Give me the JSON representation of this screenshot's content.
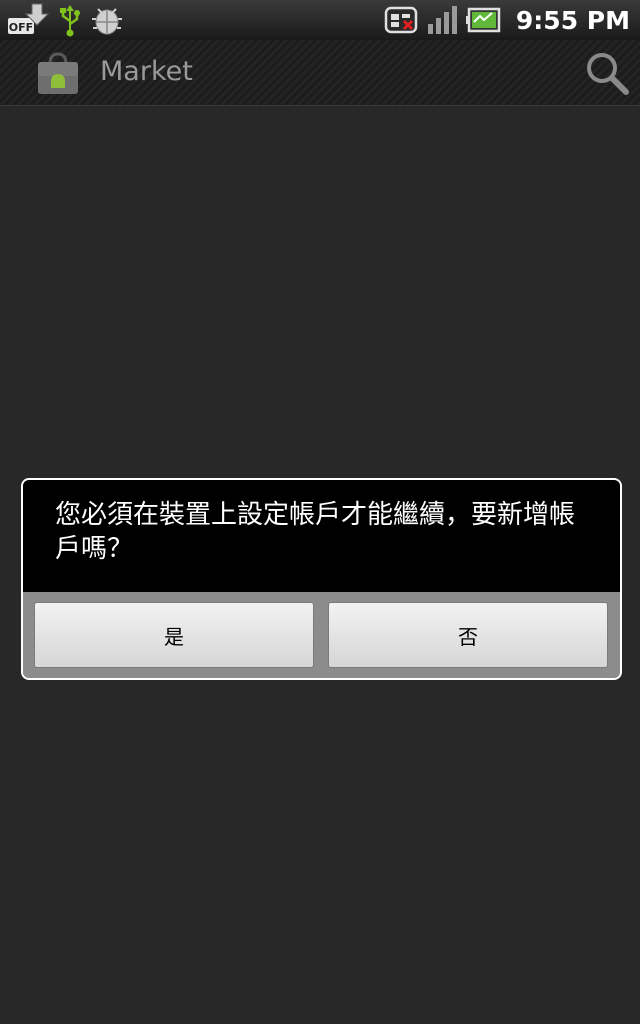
{
  "status_bar": {
    "time": "9:55 PM",
    "icons": [
      "off-badge-icon",
      "download-icon",
      "usb-icon",
      "debug-icon",
      "sim-icon",
      "signal-icon",
      "battery-icon"
    ],
    "off_label": "OFF"
  },
  "title_bar": {
    "title": "Market",
    "app_icon": "market-bag-icon",
    "search_icon": "search-icon"
  },
  "dialog": {
    "message": "您必須在裝置上設定帳戶才能繼續，要新增帳戶嗎？",
    "yes_label": "是",
    "no_label": "否"
  },
  "colors": {
    "background": "#282828",
    "dialog_message_bg": "#000000",
    "dialog_button_area": "#8c8c8c",
    "usb_green": "#7fc31c"
  }
}
